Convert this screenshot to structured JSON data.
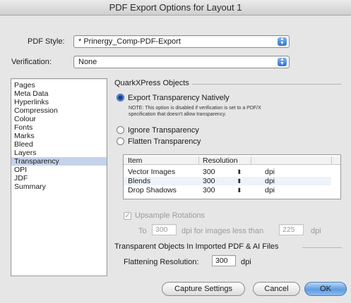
{
  "window": {
    "title": "PDF Export Options for Layout 1"
  },
  "pdf_style": {
    "label": "PDF Style:",
    "value": "* Prinergy_Comp-PDF-Export"
  },
  "verification": {
    "label": "Verification:",
    "value": "None"
  },
  "sidebar": {
    "items": [
      {
        "label": "Pages"
      },
      {
        "label": "Meta Data"
      },
      {
        "label": "Hyperlinks"
      },
      {
        "label": "Compression"
      },
      {
        "label": "Colour"
      },
      {
        "label": "Fonts"
      },
      {
        "label": "Marks"
      },
      {
        "label": "Bleed"
      },
      {
        "label": "Layers"
      },
      {
        "label": "Transparency"
      },
      {
        "label": "OPI"
      },
      {
        "label": "JDF"
      },
      {
        "label": "Summary"
      }
    ],
    "selected": "Transparency"
  },
  "quarkxpress_objects": {
    "title": "QuarkXPress Objects",
    "export_natively": "Export Transparency Natively",
    "note_line1": "NOTE: This option is disabled if verification is set to a PDF/X",
    "note_line2": "specification that doesn't allow transparency.",
    "ignore": "Ignore Transparency",
    "flatten": "Flatten Transparency",
    "selected_option": "Export Transparency Natively"
  },
  "table": {
    "headers": {
      "item": "Item",
      "resolution": "Resolution"
    },
    "rows": [
      {
        "item": "Vector Images",
        "resolution": "300",
        "unit": "dpi"
      },
      {
        "item": "Blends",
        "resolution": "300",
        "unit": "dpi"
      },
      {
        "item": "Drop Shadows",
        "resolution": "300",
        "unit": "dpi"
      }
    ]
  },
  "upsample": {
    "label": "Upsample Rotations",
    "checked": true,
    "to_label": "To",
    "to_value": "300",
    "middle_text": "dpi for images less than",
    "less_than_value": "225",
    "unit": "dpi"
  },
  "imported": {
    "title": "Transparent Objects In Imported PDF & AI Files",
    "flattening_label": "Flattening Resolution:",
    "flattening_value": "300",
    "unit": "dpi"
  },
  "buttons": {
    "capture": "Capture Settings",
    "cancel": "Cancel",
    "ok": "OK"
  },
  "colors": {
    "selection": "#c5d3ea",
    "default_button": "#5f9be0",
    "popup_arrows": "#2f73d1"
  }
}
